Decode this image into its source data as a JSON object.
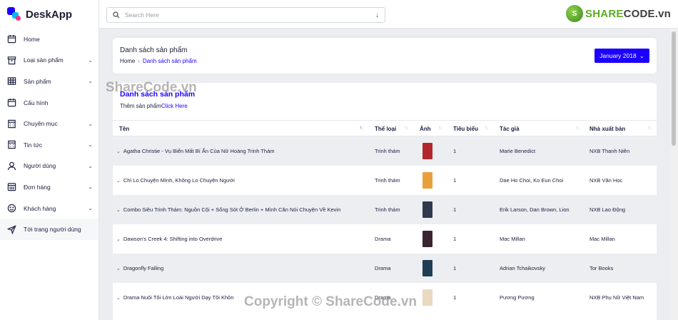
{
  "brand": {
    "name": "DeskApp"
  },
  "search": {
    "placeholder": "Search Here"
  },
  "watermark_logo": {
    "text_prefix": "S",
    "text_main": "HARE",
    "text_suffix": "CODE",
    "text_domain": ".vn"
  },
  "sidebar": {
    "items": [
      {
        "label": "Home",
        "icon": "calendar-icon",
        "has_children": false
      },
      {
        "label": "Loại sản phẩm",
        "icon": "archive-icon",
        "has_children": true
      },
      {
        "label": "Sản phẩm",
        "icon": "table-icon",
        "has_children": true
      },
      {
        "label": "Cấu hình",
        "icon": "calendar-icon",
        "has_children": false
      },
      {
        "label": "Chuyên mục",
        "icon": "calculator-icon",
        "has_children": true
      },
      {
        "label": "Tin tức",
        "icon": "calculator-icon",
        "has_children": true
      },
      {
        "label": "Người dùng",
        "icon": "user-icon",
        "has_children": true
      },
      {
        "label": "Đơn hàng",
        "icon": "bank-icon",
        "has_children": true
      },
      {
        "label": "Khách hàng",
        "icon": "smiley-icon",
        "has_children": true
      },
      {
        "label": "Tới trang người dùng",
        "icon": "send-icon",
        "has_children": false
      }
    ]
  },
  "page": {
    "title": "Danh sách sản phẩm",
    "breadcrumb": {
      "home": "Home",
      "current": "Danh sách sản phẩm"
    },
    "month_button": "January 2018"
  },
  "table": {
    "title": "Danh sách sản phẩm",
    "add_text": "Thêm sản phẩm",
    "add_link": "Click Here",
    "headers": [
      "Tên",
      "Thể loại",
      "Ảnh",
      "Tiêu biểu",
      "Tác giả",
      "Nhà xuất bản"
    ],
    "rows": [
      {
        "name": "Agatha Christie - Vụ Biến Mất Bí Ẩn Của Nữ Hoàng Trinh Thám",
        "category": "Trinh thám",
        "featured": "1",
        "author": "Marie Benedict",
        "publisher": "NXB Thanh Niên",
        "cover": "#b3262e"
      },
      {
        "name": "Chỉ Lo Chuyện Mình, Không Lo Chuyện Người",
        "category": "Trinh thám",
        "featured": "1",
        "author": "Dae Ho Choi, Ko Eun Choi",
        "publisher": "NXB Văn Học",
        "cover": "#e9a03b"
      },
      {
        "name": "Combo Siêu Trinh Thám: Nguồn Cội + Sống Sót Ở Berlin + Mình Căn Nói Chuyện Về Kevin",
        "category": "Trinh thám",
        "featured": "1",
        "author": "Erik Larson, Dan Brown, Lion",
        "publisher": "NXB Lao Động",
        "cover": "#2f3a4f"
      },
      {
        "name": "Dawson's Creek 4: Shifting into Overdrive",
        "category": "Drama",
        "featured": "1",
        "author": "Mac Millan",
        "publisher": "Mac Millan",
        "cover": "#3a2630"
      },
      {
        "name": "Dragonfly Falling",
        "category": "Drama",
        "featured": "1",
        "author": "Adrian Tchaikovsky",
        "publisher": "Tor Books",
        "cover": "#1f3d55"
      },
      {
        "name": "Drama Nuôi Tôi Lớn Loài Người Dạy Tôi Khôn",
        "category": "Drama",
        "featured": "1",
        "author": "Pương Pương",
        "publisher": "NXB Phụ Nữ Việt Nam",
        "cover": "#e8d9c0"
      }
    ]
  },
  "watermarks": {
    "top": "ShareCode.vn",
    "bottom": "Copyright © ShareCode.vn"
  }
}
